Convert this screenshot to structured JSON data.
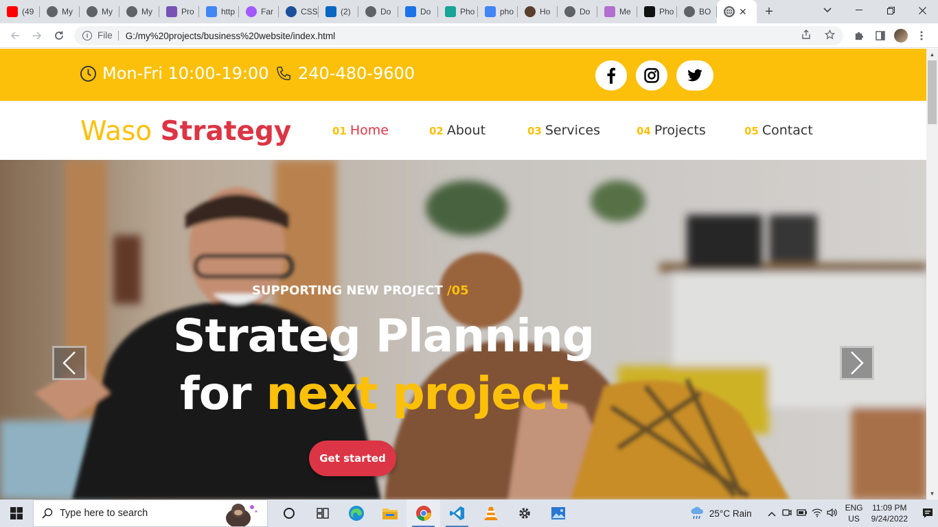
{
  "browser": {
    "tabs": [
      {
        "title": "(49",
        "icon": "youtube-icon",
        "color": "#ff0000"
      },
      {
        "title": "My",
        "icon": "globe-icon",
        "color": "#5f6368"
      },
      {
        "title": "My",
        "icon": "globe-icon",
        "color": "#5f6368"
      },
      {
        "title": "My",
        "icon": "globe-icon",
        "color": "#5f6368"
      },
      {
        "title": "Pro",
        "icon": "bootstrap-icon",
        "color": "#7952b3"
      },
      {
        "title": "http",
        "icon": "google-icon",
        "color": "#4285f4"
      },
      {
        "title": "Far",
        "icon": "figma-icon",
        "color": "#a259ff"
      },
      {
        "title": "CSS",
        "icon": "css-icon",
        "color": "#1b4f9c"
      },
      {
        "title": "(2)",
        "icon": "linkedin-icon",
        "color": "#0a66c2"
      },
      {
        "title": "Do",
        "icon": "globe-icon",
        "color": "#5f6368"
      },
      {
        "title": "Do",
        "icon": "download-icon",
        "color": "#1a73e8"
      },
      {
        "title": "Pho",
        "icon": "photopea-icon",
        "color": "#18a497"
      },
      {
        "title": "pho",
        "icon": "google-icon",
        "color": "#4285f4"
      },
      {
        "title": "Ho",
        "icon": "avatar-icon",
        "color": "#5a3e2b"
      },
      {
        "title": "Do",
        "icon": "globe-icon",
        "color": "#5f6368"
      },
      {
        "title": "Me",
        "icon": "gradient-icon",
        "color": "#b36fd0"
      },
      {
        "title": "Pho",
        "icon": "unsplash-icon",
        "color": "#111111"
      },
      {
        "title": "BO",
        "icon": "globe-icon",
        "color": "#5f6368"
      }
    ],
    "active_tab_close": "✕",
    "new_tab": "+",
    "address": {
      "scheme_label": "File",
      "url": "G:/my%20projects/business%20website/index.html"
    }
  },
  "site": {
    "topbar": {
      "hours": "Mon-Fri 10:00-19:00",
      "phone": "240-480-9600",
      "social": [
        "facebook-icon",
        "instagram-icon",
        "twitter-icon"
      ]
    },
    "logo": {
      "part1": "Waso",
      "part2": "Strategy"
    },
    "nav": [
      {
        "num": "01",
        "label": "Home",
        "active": true
      },
      {
        "num": "02",
        "label": "About",
        "active": false
      },
      {
        "num": "03",
        "label": "Services",
        "active": false
      },
      {
        "num": "04",
        "label": "Projects",
        "active": false
      },
      {
        "num": "05",
        "label": "Contact",
        "active": false
      }
    ],
    "hero": {
      "kicker": "SUPPORTING NEW PROJECT",
      "kicker_num": "/05",
      "title_line1": "Strateg Planning",
      "title_line2_a": "for",
      "title_line2_b": "next project",
      "cta": "Get started"
    },
    "colors": {
      "accent": "#fcc00a",
      "brand": "#dc3545"
    }
  },
  "taskbar": {
    "search_placeholder": "Type here to search",
    "weather": "25°C  Rain",
    "lang": "ENG",
    "region": "US",
    "time": "11:09 PM",
    "date": "9/24/2022"
  }
}
